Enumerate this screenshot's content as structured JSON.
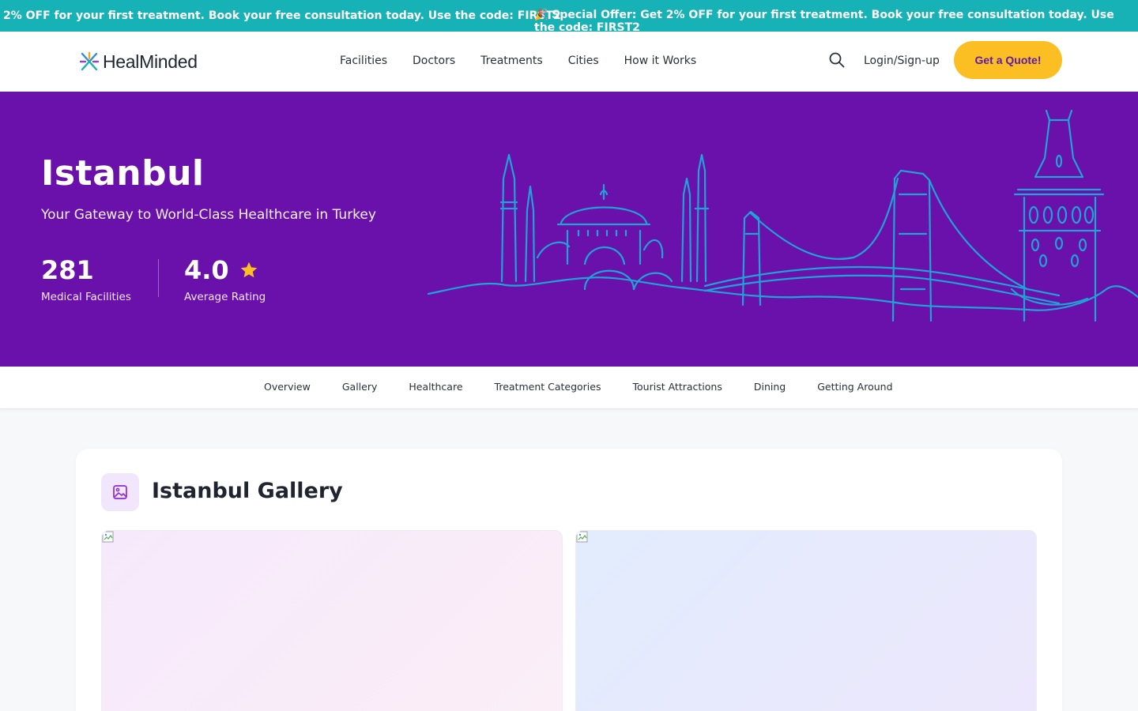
{
  "promo": {
    "message_1": "2% OFF for your first treatment. Book your free consultation today. Use the code: FIRST2",
    "message_2": "🎉 Special Offer: Get 2% OFF for your first treatment. Book your free consultation today. Use the code: FIRST2"
  },
  "header": {
    "logo_text": "HealMinded",
    "nav": [
      "Facilities",
      "Doctors",
      "Treatments",
      "Cities",
      "How it Works"
    ],
    "login_label": "Login/Sign-up",
    "quote_label": "Get a Quote!"
  },
  "hero": {
    "title": "Istanbul",
    "subtitle": "Your Gateway to World-Class Healthcare in Turkey",
    "stats": [
      {
        "value": "281",
        "label": "Medical Facilities"
      },
      {
        "value": "4.0",
        "label": "Average Rating"
      }
    ]
  },
  "section_tabs": [
    "Overview",
    "Gallery",
    "Healthcare",
    "Treatment Categories",
    "Tourist Attractions",
    "Dining",
    "Getting Around"
  ],
  "gallery": {
    "title": "Istanbul Gallery"
  },
  "colors": {
    "promo_bg": "#17b2b5",
    "hero_bg": "#6a11ab",
    "accent_yellow": "#fbbf24",
    "skyline_stroke": "#1fa3d6",
    "quote_text": "#5b1aa8"
  },
  "icons": [
    "logo-mark-icon",
    "search-icon",
    "star-icon",
    "image-icon",
    "broken-image-icon"
  ]
}
